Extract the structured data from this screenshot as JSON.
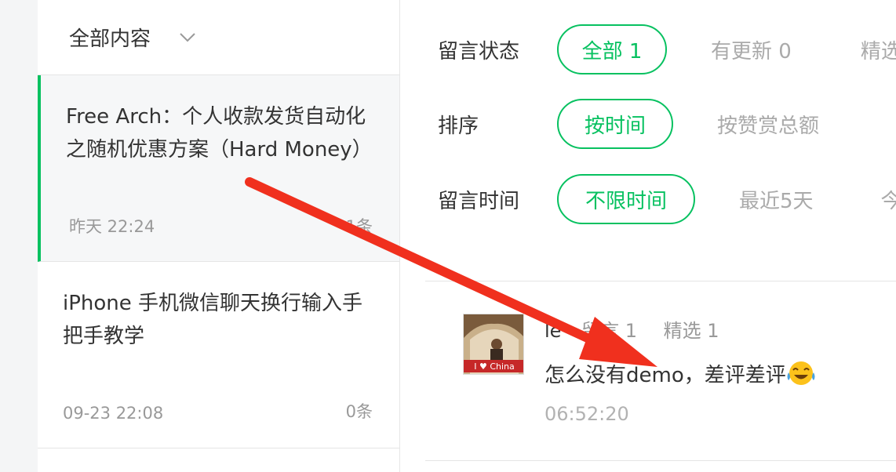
{
  "sidebar": {
    "filter_label": "全部内容",
    "articles": [
      {
        "title": "Free Arch：个人收款发货自动化之随机优惠方案（Hard Money）",
        "time": "昨天 22:24",
        "count": "1条"
      },
      {
        "title": "iPhone 手机微信聊天换行输入手把手教学",
        "time": "09-23 22:08",
        "count": "0条"
      }
    ]
  },
  "filters": {
    "status": {
      "label": "留言状态",
      "options": [
        "全部 1",
        "有更新 0",
        "精选"
      ]
    },
    "sort": {
      "label": "排序",
      "options": [
        "按时间",
        "按赞赏总额"
      ]
    },
    "time": {
      "label": "留言时间",
      "options": [
        "不限时间",
        "最近5天",
        "今"
      ]
    }
  },
  "comment": {
    "author": "le",
    "comments_stat": "留言 1",
    "featured_stat": "精选 1",
    "text": "怎么没有demo，差评差评",
    "emoji": "tears-of-joy",
    "time": "06:52:20",
    "avatar_badge": "I ♥ China"
  },
  "colors": {
    "accent": "#07c160",
    "annotation_arrow": "#f0301e"
  }
}
